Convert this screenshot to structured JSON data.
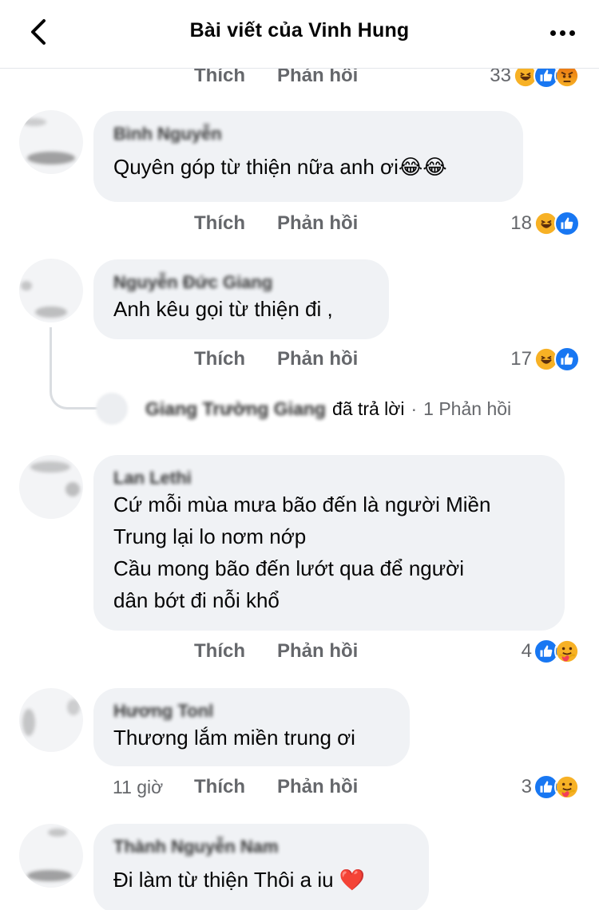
{
  "header": {
    "title": "Bài viết của Vinh Hung"
  },
  "labels": {
    "like": "Thích",
    "reply": "Phản hồi"
  },
  "comments": [
    {
      "author": "Bình Nguyễn",
      "text": "Quyên góp từ thiện nữa anh ơi😂😂",
      "time": "",
      "reaction_count": "18",
      "reactions": [
        "haha",
        "like"
      ]
    },
    {
      "author": "Nguyễn Đức Giang",
      "text": "Anh kêu gọi từ thiện đi ,",
      "time": "",
      "reaction_count": "17",
      "reactions": [
        "haha",
        "like"
      ],
      "reply_summary": {
        "author": "Giang Trường Giang",
        "action": "đã trả lời",
        "count": "1 Phản hồi"
      }
    },
    {
      "author": "Lan Lethi",
      "text_lines": [
        "Cứ mỗi mùa mưa bão đến là người Miền",
        "Trung lại lo nơm nớp",
        "Cầu mong bão đến lướt qua để người",
        "dân bớt đi nỗi khổ"
      ],
      "time": "",
      "reaction_count": "4",
      "reactions": [
        "like",
        "care"
      ]
    },
    {
      "author": "Hương Tonl",
      "text": "Thương lắm miền trung ơi",
      "time": "11 giờ",
      "reaction_count": "3",
      "reactions": [
        "like",
        "care"
      ]
    },
    {
      "author": "Thành Nguyễn Nam",
      "text": "Đi làm từ thiện Thôi a iu ❤️",
      "time": "",
      "reaction_count": "",
      "reactions": []
    }
  ],
  "top_partial_row": {
    "reaction_count": "33",
    "reactions": [
      "haha",
      "like",
      "angry"
    ]
  },
  "icons": {
    "back": "chevron-left-icon",
    "more": "more-horizontal-icon",
    "like_reaction": "thumbs-up-icon",
    "haha_reaction": "laughing-face-icon",
    "care_reaction": "care-hug-icon",
    "angry_reaction": "angry-face-icon"
  },
  "colors": {
    "bubble": "#f0f2f5",
    "secondary_text": "#65676b",
    "like_blue": "#1877f2"
  }
}
